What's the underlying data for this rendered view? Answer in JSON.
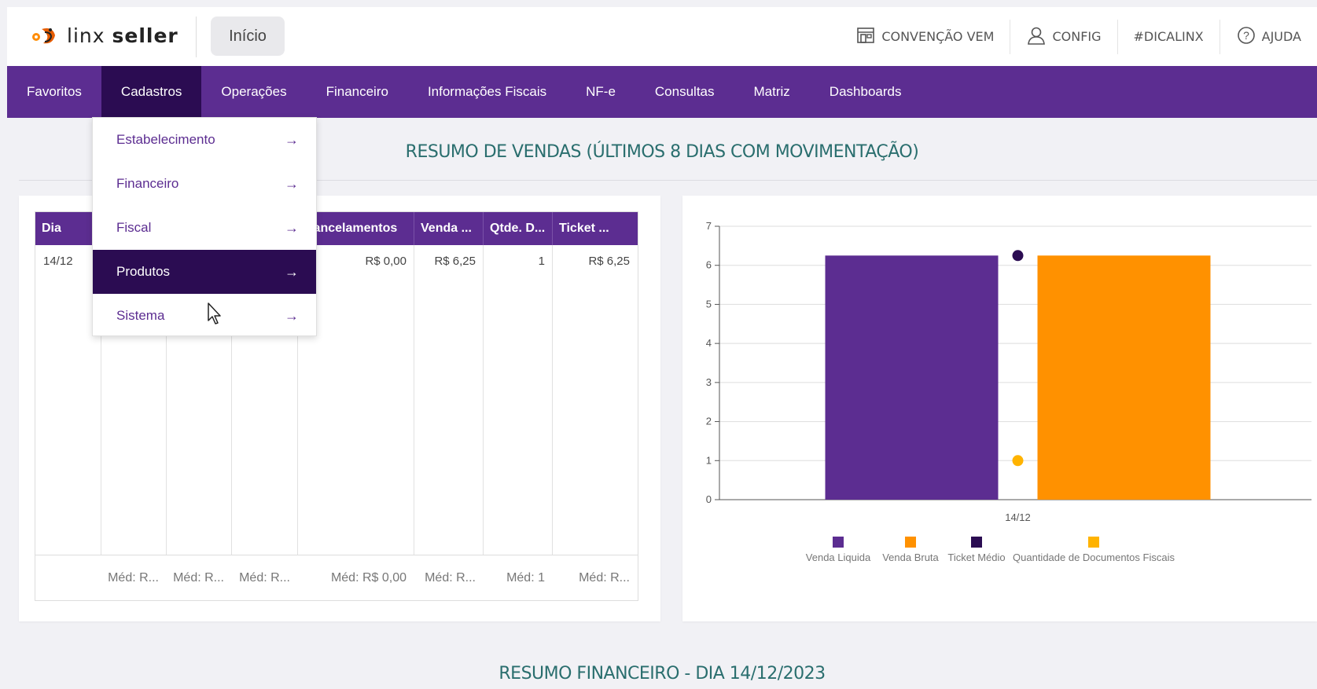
{
  "header": {
    "logo_text_light": "linx ",
    "logo_text_bold": "seller",
    "home_label": "Início",
    "links": [
      {
        "label": "CONVENÇÃO VEM",
        "icon": "store-icon"
      },
      {
        "label": "CONFIG",
        "icon": "user-icon"
      },
      {
        "label": "#DICALINX",
        "icon": ""
      },
      {
        "label": "AJUDA",
        "icon": "help-icon"
      }
    ]
  },
  "nav": {
    "items": [
      "Favoritos",
      "Cadastros",
      "Operações",
      "Financeiro",
      "Informações Fiscais",
      "NF-e",
      "Consultas",
      "Matriz",
      "Dashboards"
    ],
    "active": "Cadastros"
  },
  "dropdown": {
    "items": [
      {
        "label": "Estabelecimento",
        "arrow": "→"
      },
      {
        "label": "Financeiro",
        "arrow": "→"
      },
      {
        "label": "Fiscal",
        "arrow": "→"
      },
      {
        "label": "Produtos",
        "arrow": "→"
      },
      {
        "label": "Sistema",
        "arrow": "→"
      }
    ],
    "active": "Produtos"
  },
  "sales_summary": {
    "title": "RESUMO DE VENDAS (ÚLTIMOS 8 DIAS COM MOVIMENTAÇÃO)",
    "table": {
      "headers": [
        "Dia",
        "",
        "",
        "",
        "Cancelamentos",
        "Venda ...",
        "Qtde. D...",
        "Ticket ..."
      ],
      "rows": [
        [
          "14/12",
          "",
          "",
          "",
          "R$ 0,00",
          "R$ 6,25",
          "1",
          "R$ 6,25"
        ]
      ],
      "footer": [
        "",
        "Méd: R...",
        "Méd: R...",
        "Méd: R...",
        "Méd: R$ 0,00",
        "Méd: R...",
        "Méd: 1",
        "Méd: R..."
      ]
    }
  },
  "financial_summary": {
    "title": "RESUMO FINANCEIRO - DIA 14/12/2023"
  },
  "chart_data": {
    "type": "bar",
    "categories": [
      "14/12"
    ],
    "ylim": [
      0,
      7
    ],
    "yticks": [
      "0",
      "1",
      "2",
      "3",
      "4",
      "5",
      "6",
      "7"
    ],
    "grid": true,
    "legend_position": "bottom",
    "series": [
      {
        "name": "Venda Liquida",
        "kind": "bar",
        "values": [
          6.25
        ],
        "color": "#5c2d91"
      },
      {
        "name": "Venda Bruta",
        "kind": "bar",
        "values": [
          6.25
        ],
        "color": "#ff9100"
      },
      {
        "name": "Ticket Médio",
        "kind": "point",
        "values": [
          6.25
        ],
        "color": "#2b0c52"
      },
      {
        "name": "Quantidade de Documentos Fiscais",
        "kind": "point",
        "values": [
          1
        ],
        "color": "#ffb300"
      }
    ]
  }
}
